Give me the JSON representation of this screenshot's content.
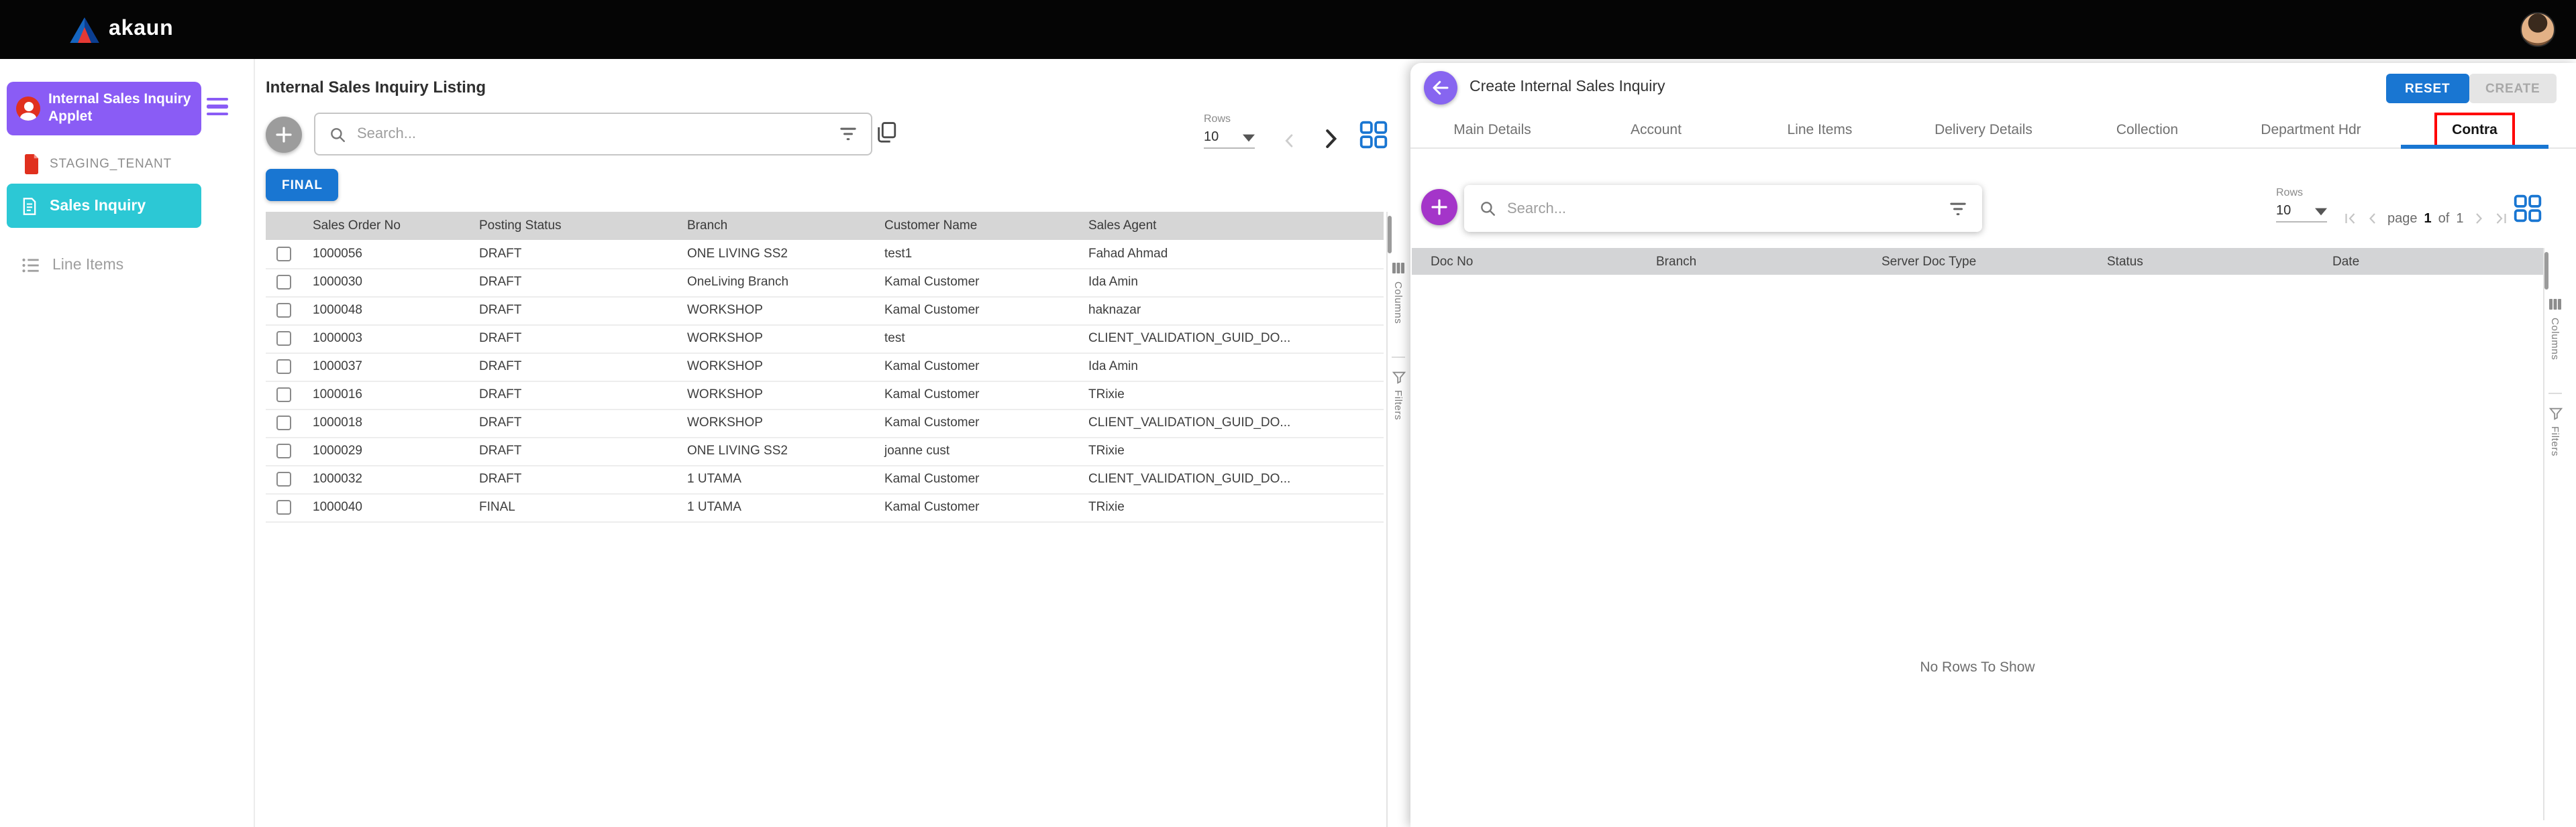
{
  "topbar": {
    "brand": "akaun"
  },
  "sidebar": {
    "applet_name": "Internal Sales Inquiry Applet",
    "tenant": "STAGING_TENANT",
    "items": [
      {
        "label": "Sales Inquiry",
        "active": true
      },
      {
        "label": "Line Items",
        "active": false
      }
    ]
  },
  "listing": {
    "title": "Internal Sales Inquiry Listing",
    "search_placeholder": "Search...",
    "rows_label": "Rows",
    "rows_per_page": "10",
    "status_filter_button": "FINAL",
    "columns": [
      "Sales Order No",
      "Posting Status",
      "Branch",
      "Customer Name",
      "Sales Agent"
    ],
    "rows": [
      [
        "1000056",
        "DRAFT",
        "ONE LIVING SS2",
        "test1",
        "Fahad Ahmad"
      ],
      [
        "1000030",
        "DRAFT",
        "OneLiving Branch",
        "Kamal Customer",
        "Ida Amin"
      ],
      [
        "1000048",
        "DRAFT",
        "WORKSHOP",
        "Kamal Customer",
        "haknazar"
      ],
      [
        "1000003",
        "DRAFT",
        "WORKSHOP",
        "test",
        "CLIENT_VALIDATION_GUID_DO..."
      ],
      [
        "1000037",
        "DRAFT",
        "WORKSHOP",
        "Kamal Customer",
        "Ida Amin"
      ],
      [
        "1000016",
        "DRAFT",
        "WORKSHOP",
        "Kamal Customer",
        "TRixie"
      ],
      [
        "1000018",
        "DRAFT",
        "WORKSHOP",
        "Kamal Customer",
        "CLIENT_VALIDATION_GUID_DO..."
      ],
      [
        "1000029",
        "DRAFT",
        "ONE LIVING SS2",
        "joanne cust",
        "TRixie"
      ],
      [
        "1000032",
        "DRAFT",
        "1 UTAMA",
        "Kamal Customer",
        "CLIENT_VALIDATION_GUID_DO..."
      ],
      [
        "1000040",
        "FINAL",
        "1 UTAMA",
        "Kamal Customer",
        "TRixie"
      ]
    ],
    "side_tabs": [
      "Columns",
      "Filters"
    ]
  },
  "detail": {
    "title": "Create Internal Sales Inquiry",
    "reset_button": "RESET",
    "create_button": "CREATE",
    "tabs": [
      {
        "label": "Main Details"
      },
      {
        "label": "Account"
      },
      {
        "label": "Line Items"
      },
      {
        "label": "Delivery Details"
      },
      {
        "label": "Collection"
      },
      {
        "label": "Department Hdr"
      },
      {
        "label": "Contra",
        "active": true,
        "annotated": true
      }
    ],
    "search_placeholder": "Search...",
    "rows_label": "Rows",
    "rows_per_page": "10",
    "pagination": {
      "page_label": "page",
      "current_page": "1",
      "of_label": "of",
      "total_pages": "1"
    },
    "columns": [
      "Doc No",
      "Branch",
      "Server Doc Type",
      "Status",
      "Date"
    ],
    "empty_message": "No Rows To Show",
    "side_tabs": [
      "Columns",
      "Filters"
    ]
  },
  "colors": {
    "accent_purple": "#8a5cf5",
    "accent_cyan": "#2cc8d5",
    "primary_blue": "#1976d2",
    "add_button_purple": "#a435c9",
    "annotation_red": "#ff0000"
  },
  "icons": {
    "akaun-logo-icon": "▲",
    "user-avatar": "👤",
    "menu-icon": "☰",
    "pdf-icon": "⎙",
    "document-icon": "🗎",
    "list-icon": "≡",
    "add-icon": "+",
    "search-icon": "⌕",
    "filter-icon": "≣",
    "copy-icon": "⧉",
    "grid-icon": "▦",
    "chevron-left-icon": "‹",
    "chevron-right-icon": "›",
    "first-page-icon": "|‹",
    "last-page-icon": "›|",
    "back-icon": "←",
    "caret-down-icon": "▾",
    "columns-icon": "▥",
    "funnel-icon": "▽"
  }
}
